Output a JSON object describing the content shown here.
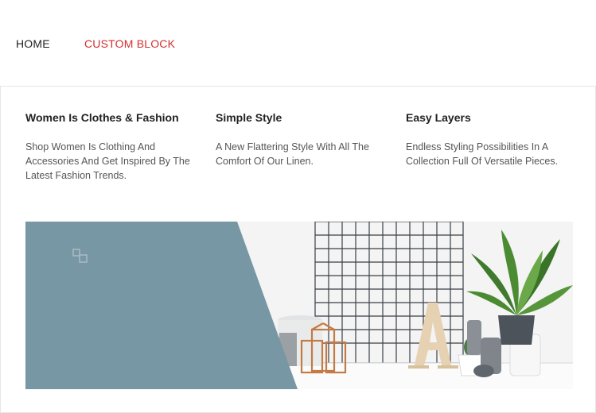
{
  "nav": {
    "items": [
      {
        "label": "HOME"
      },
      {
        "label": "CUSTOM BLOCK"
      }
    ],
    "active_color": "#d32f2f"
  },
  "mega_menu": {
    "columns": [
      {
        "title": "Women Is Clothes & Fashion",
        "text": "Shop Women Is Clothing And Accessories And Get Inspired By The Latest Fashion Trends."
      },
      {
        "title": "Simple Style",
        "text": "A New Flattering Style With All The Comfort Of Our Linen."
      },
      {
        "title": "Easy Layers",
        "text": "Endless Styling Possibilities In A Collection Full Of Versatile Pieces."
      }
    ],
    "banner": {
      "icon": "grid-squares-icon",
      "panel_color": "#7897a4"
    }
  }
}
